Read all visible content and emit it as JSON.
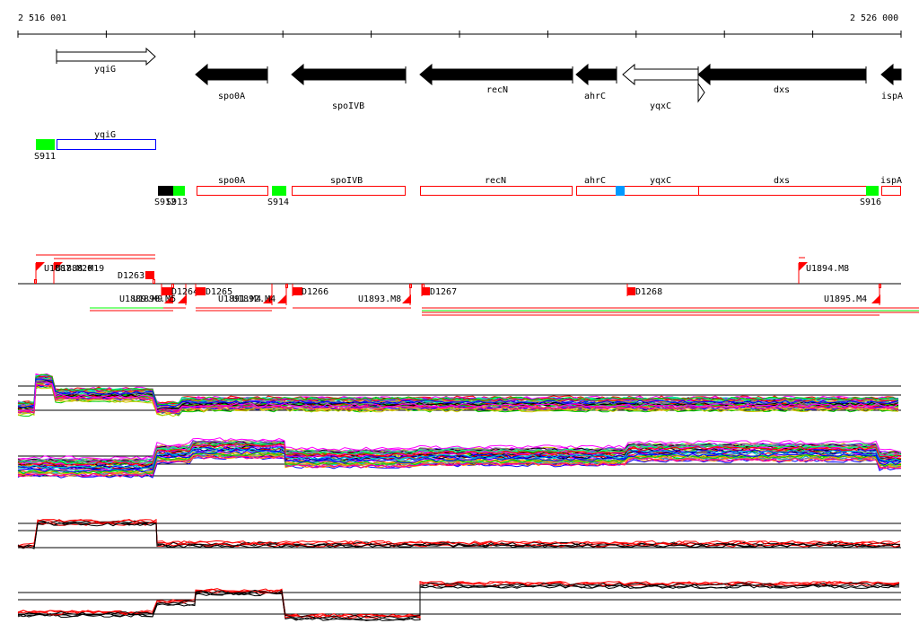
{
  "ruler": {
    "start_label": "2 516 001",
    "end_label": "2 526 000"
  },
  "genes": [
    {
      "name": "yqiG",
      "strand": "+",
      "filled": false
    },
    {
      "name": "spo0A",
      "strand": "-",
      "filled": true
    },
    {
      "name": "spoIVB",
      "strand": "-",
      "filled": true
    },
    {
      "name": "recN",
      "strand": "-",
      "filled": true
    },
    {
      "name": "ahrC",
      "strand": "-",
      "filled": true
    },
    {
      "name": "yqxC",
      "strand": "-",
      "filled": false
    },
    {
      "name": "dxs",
      "strand": "-",
      "filled": true
    },
    {
      "name": "ispA",
      "strand": "-",
      "filled": true
    }
  ],
  "operon_row1": {
    "gene": "yqiG",
    "site": "S911"
  },
  "operon_row2": {
    "genes": [
      "spo0A",
      "spoIVB",
      "recN",
      "ahrC",
      "yqxC",
      "dxs",
      "ispA"
    ],
    "sites": [
      "S912",
      "S913",
      "S914",
      "S916"
    ]
  },
  "transcripts": {
    "upstream": [
      "U1887.M20",
      "U1888.M19",
      "U1894.M8"
    ],
    "downstream": [
      "D1263",
      "D1264",
      "D1265",
      "D1266",
      "D1267",
      "D1268"
    ],
    "lower": [
      "U1889.M9",
      "U1890.M5",
      "U1891.M4",
      "U1892.M4",
      "U1893.M8",
      "U1895.M4"
    ]
  },
  "colors": {
    "gene_fill": "#000000",
    "box_red": "#ff0000",
    "box_blue": "#0000ff",
    "site_green": "#00ff00",
    "site_blue": "#0099ff",
    "trace_palette": [
      "#ff0000",
      "#00cc00",
      "#0000ff",
      "#ff00ff",
      "#00cccc",
      "#cccc00",
      "#ff8800",
      "#8800ff",
      "#000000",
      "#888888",
      "#00ff88",
      "#ff0088"
    ]
  }
}
